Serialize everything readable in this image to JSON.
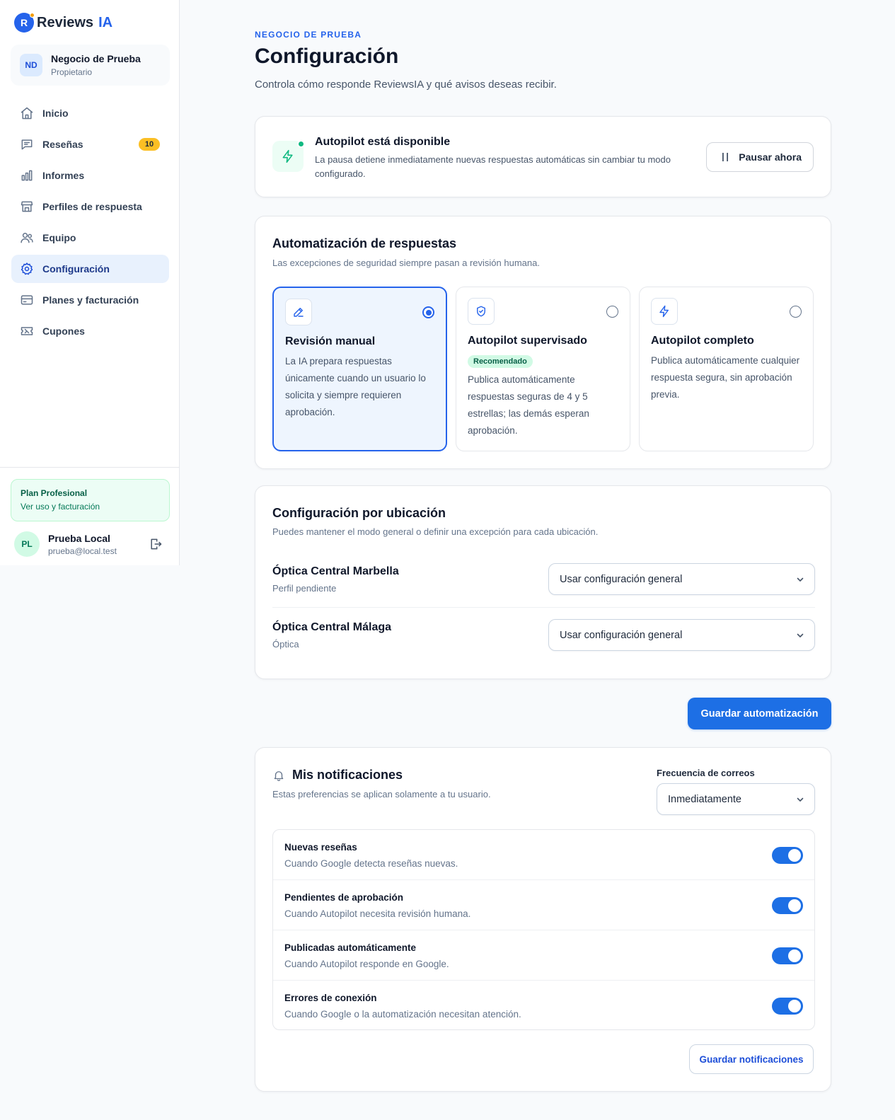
{
  "brand": {
    "logo_letter": "R",
    "name": "Reviews",
    "suffix": "IA"
  },
  "business": {
    "initials": "ND",
    "name": "Negocio de Prueba",
    "role": "Propietario"
  },
  "nav": {
    "items": [
      {
        "label": "Inicio",
        "icon": "home-icon"
      },
      {
        "label": "Reseñas",
        "icon": "message-icon",
        "badge": "10"
      },
      {
        "label": "Informes",
        "icon": "bar-chart-icon"
      },
      {
        "label": "Perfiles de respuesta",
        "icon": "store-icon"
      },
      {
        "label": "Equipo",
        "icon": "users-icon"
      },
      {
        "label": "Configuración",
        "icon": "gear-icon",
        "active": true
      },
      {
        "label": "Planes y facturación",
        "icon": "credit-card-icon"
      },
      {
        "label": "Cupones",
        "icon": "ticket-icon"
      }
    ]
  },
  "plan": {
    "name": "Plan Profesional",
    "link": "Ver uso y facturación"
  },
  "user": {
    "initials": "PL",
    "name": "Prueba Local",
    "email": "prueba@local.test"
  },
  "header": {
    "eyebrow": "NEGOCIO DE PRUEBA",
    "title": "Configuración",
    "subtitle": "Controla cómo responde ReviewsIA y qué avisos deseas recibir."
  },
  "autopilot_status": {
    "title": "Autopilot está disponible",
    "description": "La pausa detiene inmediatamente nuevas respuestas automáticas sin cambiar tu modo configurado.",
    "pause_label": "Pausar ahora"
  },
  "automation": {
    "title": "Automatización de respuestas",
    "subtitle": "Las excepciones de seguridad siempre pasan a revisión humana.",
    "modes": [
      {
        "title": "Revisión manual",
        "icon": "edit-icon",
        "selected": true,
        "badge": "",
        "description": "La IA prepara respuestas únicamente cuando un usuario lo solicita y siempre requieren aprobación."
      },
      {
        "title": "Autopilot supervisado",
        "icon": "shield-check-icon",
        "selected": false,
        "badge": "Recomendado",
        "description": "Publica automáticamente respuestas seguras de 4 y 5 estrellas; las demás esperan aprobación."
      },
      {
        "title": "Autopilot completo",
        "icon": "lightning-icon",
        "selected": false,
        "badge": "",
        "description": "Publica automáticamente cualquier respuesta segura, sin aprobación previa."
      }
    ]
  },
  "locations": {
    "title": "Configuración por ubicación",
    "subtitle": "Puedes mantener el modo general o definir una excepción para cada ubicación.",
    "items": [
      {
        "name": "Óptica Central Marbella",
        "sub": "Perfil pendiente",
        "value": "Usar configuración general"
      },
      {
        "name": "Óptica Central Málaga",
        "sub": "Óptica",
        "value": "Usar configuración general"
      }
    ]
  },
  "save_automation_label": "Guardar automatización",
  "notifications": {
    "title": "Mis notificaciones",
    "subtitle": "Estas preferencias se aplican solamente a tu usuario.",
    "frequency_label": "Frecuencia de correos",
    "frequency_value": "Inmediatamente",
    "items": [
      {
        "title": "Nuevas reseñas",
        "description": "Cuando Google detecta reseñas nuevas.",
        "enabled": true
      },
      {
        "title": "Pendientes de aprobación",
        "description": "Cuando Autopilot necesita revisión humana.",
        "enabled": true
      },
      {
        "title": "Publicadas automáticamente",
        "description": "Cuando Autopilot responde en Google.",
        "enabled": true
      },
      {
        "title": "Errores de conexión",
        "description": "Cuando Google o la automatización necesitan atención.",
        "enabled": true
      }
    ],
    "save_label": "Guardar notificaciones"
  },
  "colors": {
    "primary": "#1d6fe5",
    "success": "#10b981",
    "badge": "#fbbf24"
  }
}
